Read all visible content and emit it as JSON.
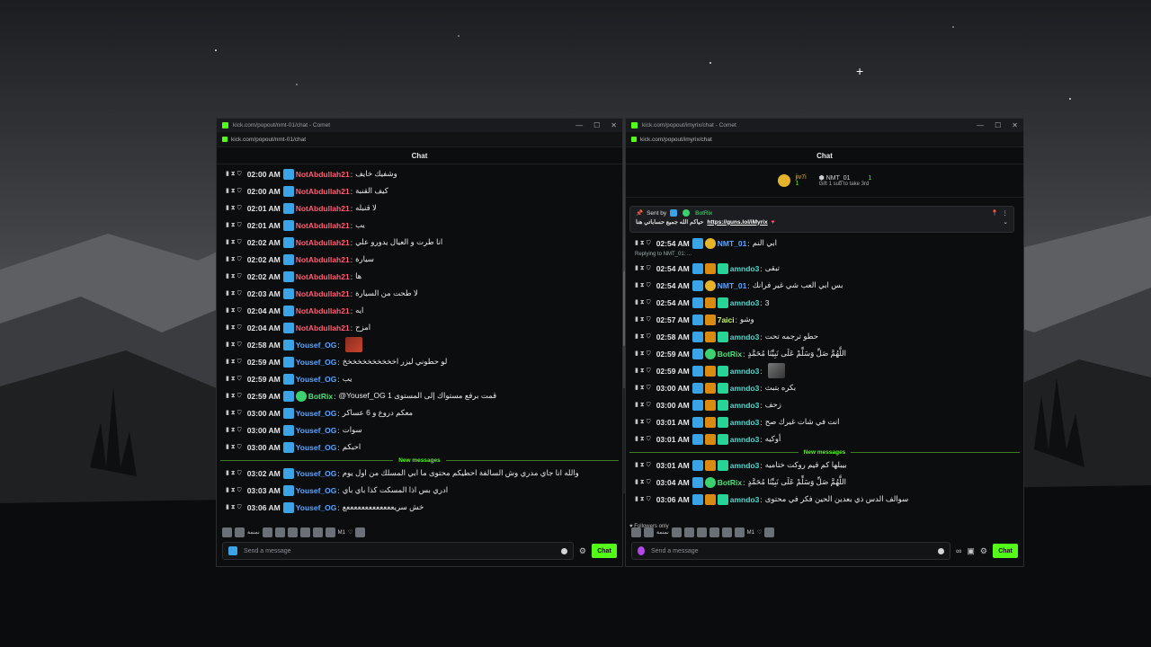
{
  "left_window": {
    "title": "kick.com/popout/nmt-01/chat - Comet",
    "address": "kick.com/popout/nmt-01/chat",
    "chat_header": "Chat",
    "messages": [
      {
        "time": "02:00 AM",
        "user": "NotAbdullah21",
        "text": "وشفيك خايف"
      },
      {
        "time": "02:00 AM",
        "user": "NotAbdullah21",
        "text": "كيف القنبة"
      },
      {
        "time": "02:01 AM",
        "user": "NotAbdullah21",
        "text": "لا قنبله"
      },
      {
        "time": "02:01 AM",
        "user": "NotAbdullah21",
        "text": "يب"
      },
      {
        "time": "02:02 AM",
        "user": "NotAbdullah21",
        "text": "انا طرت و العيال يدورو علي"
      },
      {
        "time": "02:02 AM",
        "user": "NotAbdullah21",
        "text": "سيارة"
      },
      {
        "time": "02:02 AM",
        "user": "NotAbdullah21",
        "text": "ها"
      },
      {
        "time": "02:03 AM",
        "user": "NotAbdullah21",
        "text": "لا طحت من السيارة"
      },
      {
        "time": "02:04 AM",
        "user": "NotAbdullah21",
        "text": "ايه"
      },
      {
        "time": "02:04 AM",
        "user": "NotAbdullah21",
        "text": "امزح"
      },
      {
        "time": "02:58 AM",
        "user": "Yousef_OG",
        "text": ""
      },
      {
        "time": "02:59 AM",
        "user": "Yousef_OG",
        "text": "لو حطوني ليزر اخخخخخخخخخخخ"
      },
      {
        "time": "02:59 AM",
        "user": "Yousef_OG",
        "text": "يب"
      },
      {
        "time": "02:59 AM",
        "user": "BotRix",
        "text": "@Yousef_OG قمت برفع مستواك إلى المستوى 1"
      },
      {
        "time": "03:00 AM",
        "user": "Yousef_OG",
        "text": "معكم دروع و 6 عساكر"
      },
      {
        "time": "03:00 AM",
        "user": "Yousef_OG",
        "text": "سوات"
      },
      {
        "time": "03:00 AM",
        "user": "Yousef_OG",
        "text": "احبكم"
      }
    ],
    "new_messages_label": "New messages",
    "new_messages": [
      {
        "time": "03:02 AM",
        "user": "Yousef_OG",
        "text": "والله انا جاي مدري وش السالفة احطيكم محتوى ما ابي المسلك من اول يوم"
      },
      {
        "time": "03:03 AM",
        "user": "Yousef_OG",
        "text": "ادري بس اذا المسكت كذا باي باي"
      },
      {
        "time": "03:06 AM",
        "user": "Yousef_OG",
        "text": "خش سريعععععععععععععع"
      }
    ],
    "emote_bar_text": "نمنمة",
    "emote_bar_count": "M1",
    "input_placeholder": "Send a message",
    "send_label": "Chat"
  },
  "right_window": {
    "title": "kick.com/popout/imyrix/chat - Comet",
    "address": "kick.com/popout/imyrix/chat",
    "chat_header": "Chat",
    "sub_left_name": "jiv7i",
    "sub_left_count": "1",
    "sub_right_name": "NMT_01",
    "sub_right_count": "1",
    "sub_gift_text": "Gift 1 sub to take 3rd",
    "pinned_sent_by": "Sent by",
    "pinned_user": "BotRix",
    "pinned_text": "حياكم الله جميع حساباتي هنا",
    "pinned_link": "https://guns.lol/iMyrix",
    "reply_text": "Replying to NMT_01: ...",
    "messages": [
      {
        "time": "02:54 AM",
        "user": "NMT_01",
        "text": "ابي النم",
        "cls": "u-blue"
      },
      {
        "time": "02:54 AM",
        "user": "amndo3",
        "text": "تبقى",
        "cls": "u-teal"
      },
      {
        "time": "02:54 AM",
        "user": "NMT_01",
        "text": "بس ابي العب شي غير فرانك",
        "cls": "u-blue"
      },
      {
        "time": "02:54 AM",
        "user": "amndo3",
        "text": "3",
        "cls": "u-teal"
      },
      {
        "time": "02:57 AM",
        "user": "7aici",
        "text": "وشو",
        "cls": "u-lime"
      },
      {
        "time": "02:58 AM",
        "user": "amndo3",
        "text": "حطو ترجمه تحت",
        "cls": "u-teal"
      },
      {
        "time": "02:59 AM",
        "user": "BotRix",
        "text": "اللَّهُمَّ صَلِّ وَسَلِّمْ عَلَى نَبِيِّنَا مُحَمَّدٍ",
        "cls": "u-green"
      },
      {
        "time": "02:59 AM",
        "user": "amndo3",
        "text": "",
        "cls": "u-teal"
      },
      {
        "time": "03:00 AM",
        "user": "amndo3",
        "text": "بكره بتبث",
        "cls": "u-teal"
      },
      {
        "time": "03:00 AM",
        "user": "amndo3",
        "text": "زحف",
        "cls": "u-teal"
      },
      {
        "time": "03:01 AM",
        "user": "amndo3",
        "text": "انت في شات غيرك صح",
        "cls": "u-teal"
      },
      {
        "time": "03:01 AM",
        "user": "amndo3",
        "text": "أوكيه",
        "cls": "u-teal"
      }
    ],
    "new_messages_label": "New messages",
    "new_messages": [
      {
        "time": "03:01 AM",
        "user": "amndo3",
        "text": "بيبلها كم قيم روكت ختاميه",
        "cls": "u-teal"
      },
      {
        "time": "03:04 AM",
        "user": "BotRix",
        "text": "اللَّهُمَّ صَلِّ وَسَلِّمْ عَلَى نَبِيِّنَا مُحَمَّدٍ",
        "cls": "u-green"
      },
      {
        "time": "03:06 AM",
        "user": "amndo3",
        "text": "سوالف الدس ذي بعدين الحين فكر في محتوى",
        "cls": "u-teal"
      }
    ],
    "followers_only": "Followers only",
    "emote_bar_text": "نمنمة",
    "emote_bar_count": "M1",
    "input_placeholder": "Send a message",
    "send_label": "Chat"
  }
}
